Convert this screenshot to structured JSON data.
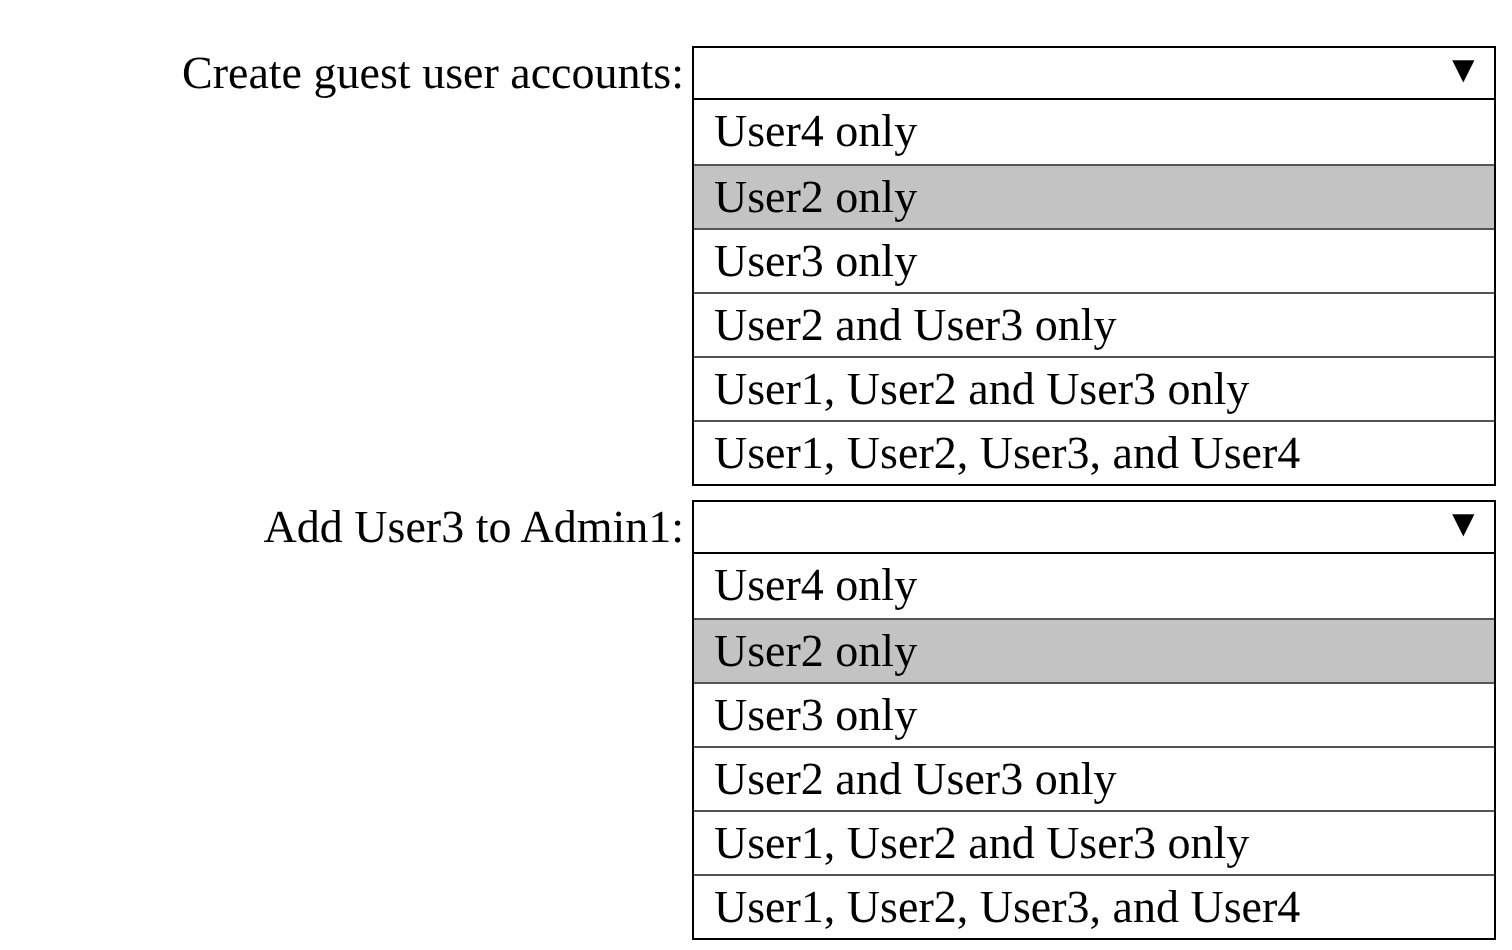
{
  "questions": [
    {
      "label": "Create guest user accounts:",
      "arrow": "▼",
      "options": [
        {
          "text": "User4 only",
          "selected": false
        },
        {
          "text": "User2 only",
          "selected": true
        },
        {
          "text": "User3 only",
          "selected": false
        },
        {
          "text": "User2 and User3 only",
          "selected": false
        },
        {
          "text": "User1, User2 and User3 only",
          "selected": false
        },
        {
          "text": "User1, User2, User3, and User4",
          "selected": false
        }
      ]
    },
    {
      "label": "Add User3 to Admin1:",
      "arrow": "▼",
      "options": [
        {
          "text": "User4 only",
          "selected": false
        },
        {
          "text": "User2 only",
          "selected": true
        },
        {
          "text": "User3 only",
          "selected": false
        },
        {
          "text": "User2 and User3 only",
          "selected": false
        },
        {
          "text": "User1, User2 and User3 only",
          "selected": false
        },
        {
          "text": "User1, User2, User3, and User4",
          "selected": false
        }
      ]
    }
  ]
}
